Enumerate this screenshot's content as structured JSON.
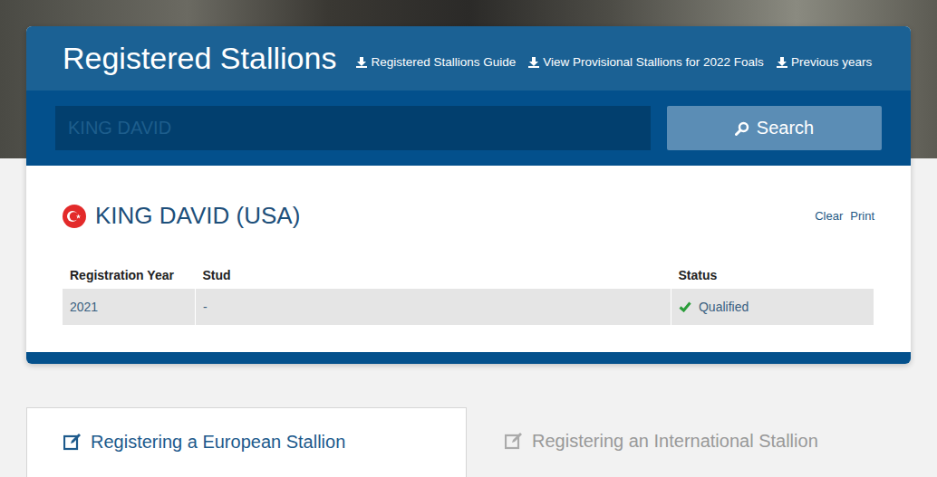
{
  "header": {
    "title": "Registered Stallions",
    "links": [
      "Registered Stallions Guide",
      "View Provisional Stallions for 2022 Foals",
      "Previous years"
    ]
  },
  "search": {
    "placeholder": "KING DAVID",
    "button": "Search"
  },
  "result": {
    "name": "KING DAVID (USA)",
    "actions": [
      "Clear",
      "Print"
    ]
  },
  "table": {
    "columns": [
      "Registration Year",
      "Stud",
      "Status"
    ],
    "rows": [
      {
        "cells": [
          "2021",
          "-",
          "Qualified"
        ],
        "qualified": true
      }
    ]
  },
  "tabs": [
    {
      "label": "Registering a European Stallion",
      "selected": true
    },
    {
      "label": "Registering an International Stallion",
      "selected": false
    }
  ]
}
